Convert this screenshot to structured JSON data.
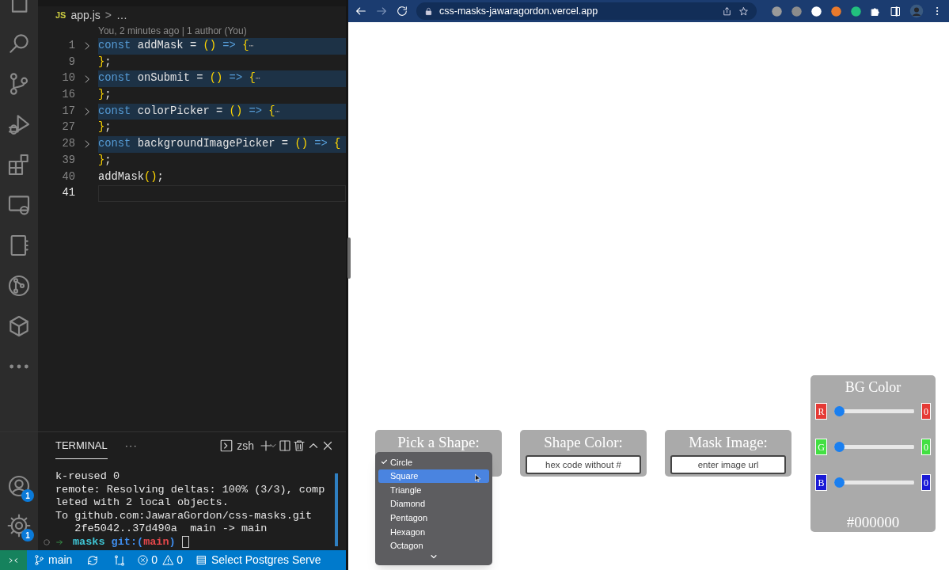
{
  "activity_bar": {
    "account_badge": "1",
    "settings_badge": "1"
  },
  "editor": {
    "breadcrumb": {
      "badge": "JS",
      "file": "app.js",
      "separator": ">",
      "rest": "…"
    },
    "blame": "You, 2 minutes ago | 1 author (You)",
    "lines": [
      {
        "number": "1",
        "folded": true,
        "current": false,
        "tokens": [
          {
            "text": "const ",
            "kind": "keyword"
          },
          {
            "text": "addMask = ",
            "kind": "plain"
          },
          {
            "text": "()",
            "kind": "bracket"
          },
          {
            "text": " => ",
            "kind": "keyword"
          },
          {
            "text": "{",
            "kind": "bracket"
          },
          {
            "text": "⋯",
            "kind": "fold"
          }
        ]
      },
      {
        "number": "9",
        "folded": false,
        "current": false,
        "tokens": [
          {
            "text": "}",
            "kind": "bracket"
          },
          {
            "text": ";",
            "kind": "plain"
          }
        ]
      },
      {
        "number": "10",
        "folded": true,
        "current": false,
        "tokens": [
          {
            "text": "const ",
            "kind": "keyword"
          },
          {
            "text": "onSubmit = ",
            "kind": "plain"
          },
          {
            "text": "()",
            "kind": "bracket"
          },
          {
            "text": " => ",
            "kind": "keyword"
          },
          {
            "text": "{",
            "kind": "bracket"
          },
          {
            "text": "⋯",
            "kind": "fold"
          }
        ]
      },
      {
        "number": "16",
        "folded": false,
        "current": false,
        "tokens": [
          {
            "text": "}",
            "kind": "bracket"
          },
          {
            "text": ";",
            "kind": "plain"
          }
        ]
      },
      {
        "number": "17",
        "folded": true,
        "current": false,
        "tokens": [
          {
            "text": "const ",
            "kind": "keyword"
          },
          {
            "text": "colorPicker = ",
            "kind": "plain"
          },
          {
            "text": "()",
            "kind": "bracket"
          },
          {
            "text": " => ",
            "kind": "keyword"
          },
          {
            "text": "{",
            "kind": "bracket"
          },
          {
            "text": "⋯",
            "kind": "fold"
          }
        ]
      },
      {
        "number": "27",
        "folded": false,
        "current": false,
        "tokens": [
          {
            "text": "}",
            "kind": "bracket"
          },
          {
            "text": ";",
            "kind": "plain"
          }
        ]
      },
      {
        "number": "28",
        "folded": true,
        "current": false,
        "tokens": [
          {
            "text": "const ",
            "kind": "keyword"
          },
          {
            "text": "backgroundImagePicker = ",
            "kind": "plain"
          },
          {
            "text": "()",
            "kind": "bracket"
          },
          {
            "text": " => ",
            "kind": "keyword"
          },
          {
            "text": "{",
            "kind": "bracket"
          }
        ]
      },
      {
        "number": "39",
        "folded": false,
        "current": false,
        "tokens": [
          {
            "text": "}",
            "kind": "bracket"
          },
          {
            "text": ";",
            "kind": "plain"
          }
        ]
      },
      {
        "number": "40",
        "folded": false,
        "current": false,
        "tokens": [
          {
            "text": "addMask",
            "kind": "plain"
          },
          {
            "text": "()",
            "kind": "bracket"
          },
          {
            "text": ";",
            "kind": "plain"
          }
        ]
      },
      {
        "number": "41",
        "folded": false,
        "current": true
      }
    ]
  },
  "terminal": {
    "tabs": [
      {
        "label": "TERMINAL",
        "selected": true
      }
    ],
    "more": "···",
    "shell": "zsh",
    "lines": [
      "k-reused 0",
      "remote: Resolving deltas: 100% (3/3), comp",
      "leted with 2 local objects.",
      "To github.com:JawaraGordon/css-masks.git",
      "   2fe5042..37d490a  main -> main"
    ],
    "prompt": {
      "dir": "masks",
      "git_open": "git:(",
      "branch": "main",
      "git_close": ")"
    }
  },
  "status_bar": {
    "branch": "main",
    "errors": "0",
    "warnings": "0",
    "database": "Select Postgres Serve"
  },
  "browser": {
    "url": "css-masks-jawaragordon.vercel.app"
  },
  "page": {
    "shape_picker": {
      "title": "Pick a Shape:",
      "options": [
        {
          "label": "Circle",
          "checked": true,
          "highlighted": false
        },
        {
          "label": "Square",
          "checked": false,
          "highlighted": true
        },
        {
          "label": "Triangle",
          "checked": false,
          "highlighted": false
        },
        {
          "label": "Diamond",
          "checked": false,
          "highlighted": false
        },
        {
          "label": "Pentagon",
          "checked": false,
          "highlighted": false
        },
        {
          "label": "Hexagon",
          "checked": false,
          "highlighted": false
        },
        {
          "label": "Octagon",
          "checked": false,
          "highlighted": false
        }
      ]
    },
    "shape_color": {
      "title": "Shape Color:",
      "placeholder": "hex code without #"
    },
    "mask_image": {
      "title": "Mask Image:",
      "placeholder": "enter image url"
    },
    "bg_color": {
      "title": "BG Color",
      "channels": [
        {
          "label": "R",
          "color": "#e53935",
          "level": 0,
          "value": "0"
        },
        {
          "label": "G",
          "color": "#43e043",
          "level": 0,
          "value": "0"
        },
        {
          "label": "B",
          "color": "#1a1ad6",
          "level": 0,
          "value": "0"
        }
      ],
      "hex": "#000000"
    }
  }
}
